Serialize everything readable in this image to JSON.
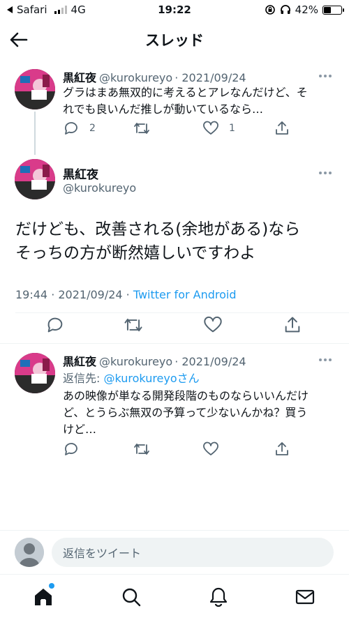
{
  "status_bar": {
    "back_app": "Safari",
    "network": "4G",
    "time": "19:22",
    "battery_percent": "42%",
    "battery_level": 0.42
  },
  "header": {
    "title": "スレッド"
  },
  "tweets": [
    {
      "display_name": "黒紅夜",
      "handle": "@kurokureyo",
      "date": "· 2021/09/24",
      "text_line1": "グラはまあ無双的に考えるとアレなんだけど、そ",
      "text_line2": "れでも良いんだ推しが動いているなら…",
      "reply_count": "2",
      "retweet_count": "",
      "like_count": "1"
    },
    {
      "display_name": "黒紅夜",
      "handle": "@kurokureyo",
      "text_line1": "だけども、改善される(余地がある)なら",
      "text_line2": "そっちの方が断然嬉しいですわよ",
      "timestamp": "19:44 · 2021/09/24 · ",
      "source": "Twitter for Android"
    },
    {
      "display_name": "黒紅夜",
      "handle": "@kurokureyo",
      "date": "· 2021/09/24",
      "reply_prefix": "返信先: ",
      "reply_target": "@kurokureyoさん",
      "text_line1": "あの映像が単なる開発段階のものならいいんだけ",
      "text_line2": "ど、とうらぶ無双の予算って少ないんかね？買う",
      "text_line3": "けど…"
    }
  ],
  "composer": {
    "placeholder": "返信をツイート"
  },
  "nav": {
    "items": [
      "home-icon",
      "search-icon",
      "notifications-icon",
      "messages-icon"
    ]
  },
  "colors": {
    "accent": "#1d9bf0",
    "secondary_text": "#536471",
    "divider": "#eff3f4"
  }
}
